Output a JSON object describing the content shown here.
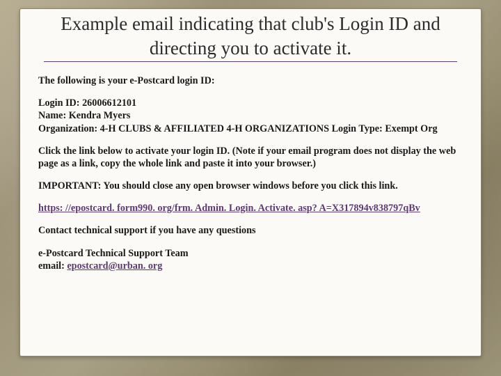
{
  "title": "Example email indicating that club's Login ID and directing you to activate it.",
  "intro": "The following is your e-Postcard login ID:",
  "details": {
    "login_id_label": "Login ID:",
    "login_id": "26006612101",
    "name_label": "Name:",
    "name": "Kendra Myers",
    "org_label": "Organization:",
    "org": "4-H CLUBS & AFFILIATED 4-H ORGANIZATIONS",
    "login_type_label": "Login Type:",
    "login_type": "Exempt Org"
  },
  "instruction1": "Click the link below to activate your login ID. (Note if your email program does not display the web page as a link, copy the whole link and paste it into your browser.)",
  "instruction2": "IMPORTANT: You should close any open browser windows before you click this link.",
  "activation_link": "https: //epostcard. form990. org/frm. Admin. Login. Activate. asp? A=X317894v838797qBv",
  "support_line": "Contact technical support if you have any questions",
  "signature": {
    "team": "e-Postcard Technical Support Team",
    "email_label": "email:",
    "email": "epostcard@urban. org"
  }
}
